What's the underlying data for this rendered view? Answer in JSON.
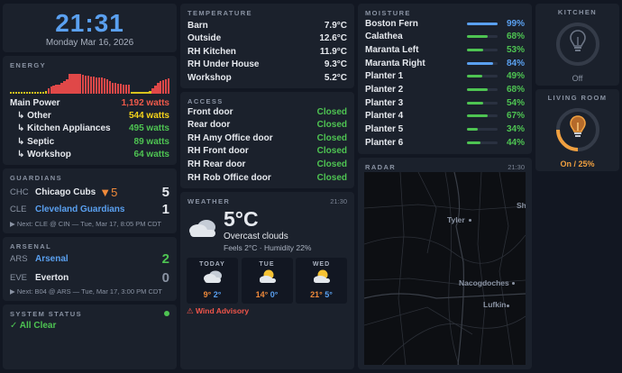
{
  "clock": {
    "time": "21:31",
    "date": "Monday Mar 16, 2026"
  },
  "energy": {
    "title": "ENERGY",
    "rows": [
      {
        "label": "Main Power",
        "value": "1,192 watts"
      },
      {
        "label": "↳ Other",
        "value": "544 watts"
      },
      {
        "label": "↳ Kitchen Appliances",
        "value": "495 watts"
      },
      {
        "label": "↳ Septic",
        "value": "89 watts"
      },
      {
        "label": "↳ Workshop",
        "value": "64 watts"
      }
    ],
    "colors": {
      "main": "#f05a4a",
      "other": "#f5d31a",
      "sub": "#4ec452",
      "bar": "#e04848",
      "low": "#d8c21e"
    }
  },
  "guardians": {
    "title": "GUARDIANS",
    "team1": {
      "abbr": "CHC",
      "name": "Chicago Cubs",
      "indicator": "▼5",
      "score": "5"
    },
    "team2": {
      "abbr": "CLE",
      "name": "Cleveland Guardians",
      "score": "1"
    },
    "next": "▶ Next: CLE @ CIN — Tue, Mar 17, 8:05 PM CDT"
  },
  "arsenal": {
    "title": "ARSENAL",
    "team1": {
      "abbr": "ARS",
      "name": "Arsenal",
      "score": "2"
    },
    "team2": {
      "abbr": "EVE",
      "name": "Everton",
      "score": "0"
    },
    "next": "▶ Next: B04 @ ARS — Tue, Mar 17, 3:00 PM CDT"
  },
  "status": {
    "title": "SYSTEM STATUS",
    "text": "✓ All Clear"
  },
  "temperature": {
    "title": "TEMPERATURE",
    "rows": [
      {
        "label": "Barn",
        "value": "7.9°C"
      },
      {
        "label": "Outside",
        "value": "12.6°C"
      },
      {
        "label": "RH Kitchen",
        "value": "11.9°C"
      },
      {
        "label": "RH Under House",
        "value": "9.3°C"
      },
      {
        "label": "Workshop",
        "value": "5.2°C"
      }
    ]
  },
  "access": {
    "title": "ACCESS",
    "rows": [
      {
        "label": "Front door",
        "value": "Closed"
      },
      {
        "label": "Rear door",
        "value": "Closed"
      },
      {
        "label": "RH Amy Office door",
        "value": "Closed"
      },
      {
        "label": "RH Front door",
        "value": "Closed"
      },
      {
        "label": "RH Rear door",
        "value": "Closed"
      },
      {
        "label": "RH Rob Office door",
        "value": "Closed"
      }
    ]
  },
  "weather": {
    "title": "WEATHER",
    "time": "21:30",
    "temp": "5°C",
    "condition": "Overcast clouds",
    "details": "Feels 2°C · Humidity 22%",
    "forecast": [
      {
        "day": "TODAY",
        "icon": "cloud-icon",
        "hi": "9°",
        "lo": "2°"
      },
      {
        "day": "TUE",
        "icon": "partly-cloudy-icon",
        "hi": "14°",
        "lo": "0°"
      },
      {
        "day": "WED",
        "icon": "partly-cloudy-icon",
        "hi": "21°",
        "lo": "5°"
      }
    ],
    "advisory": "⚠ Wind Advisory"
  },
  "moisture": {
    "title": "MOISTURE",
    "rows": [
      {
        "label": "Boston Fern",
        "value": "99%",
        "pct": 99,
        "color": "#5aa0f0"
      },
      {
        "label": "Calathea",
        "value": "68%",
        "pct": 68,
        "color": "#4ec452"
      },
      {
        "label": "Maranta Left",
        "value": "53%",
        "pct": 53,
        "color": "#4ec452"
      },
      {
        "label": "Maranta Right",
        "value": "84%",
        "pct": 84,
        "color": "#5aa0f0"
      },
      {
        "label": "Planter 1",
        "value": "49%",
        "pct": 49,
        "color": "#4ec452"
      },
      {
        "label": "Planter 2",
        "value": "68%",
        "pct": 68,
        "color": "#4ec452"
      },
      {
        "label": "Planter 3",
        "value": "54%",
        "pct": 54,
        "color": "#4ec452"
      },
      {
        "label": "Planter 4",
        "value": "67%",
        "pct": 67,
        "color": "#4ec452"
      },
      {
        "label": "Planter 5",
        "value": "34%",
        "pct": 34,
        "color": "#4ec452"
      },
      {
        "label": "Planter 6",
        "value": "44%",
        "pct": 44,
        "color": "#4ec452"
      }
    ]
  },
  "radar": {
    "title": "RADAR",
    "time": "21:30",
    "cities": [
      {
        "name": "Tyler"
      },
      {
        "name": "Nacogdoches"
      },
      {
        "name": "Lufkin"
      },
      {
        "name": "Sh"
      }
    ]
  },
  "kitchen": {
    "title": "KITCHEN",
    "state": "Off",
    "icon": "lightbulb-icon",
    "level": 0
  },
  "living": {
    "title": "LIVING ROOM",
    "state": "On / 25%",
    "icon": "lightbulb-icon",
    "level": 25
  }
}
